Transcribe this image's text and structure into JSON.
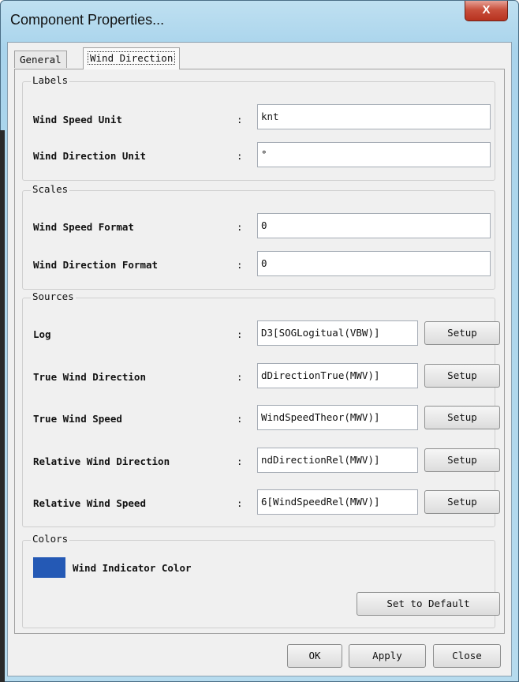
{
  "window": {
    "title": "Component Properties...",
    "close_glyph": "X"
  },
  "tabs": [
    {
      "label": "General"
    },
    {
      "label": "Wind Direction"
    }
  ],
  "labels_group": {
    "title": "Labels",
    "rows": [
      {
        "label": "Wind Speed Unit",
        "colon": ":",
        "value": "knt"
      },
      {
        "label": "Wind Direction Unit",
        "colon": ":",
        "value": "°"
      }
    ]
  },
  "scales_group": {
    "title": "Scales",
    "rows": [
      {
        "label": "Wind Speed Format",
        "colon": ":",
        "value": "0"
      },
      {
        "label": "Wind Direction Format",
        "colon": ":",
        "value": "0"
      }
    ]
  },
  "sources_group": {
    "title": "Sources",
    "setup_label": "Setup",
    "rows": [
      {
        "label": "Log",
        "colon": ":",
        "value": "D3[SOGLogitual(VBW)]"
      },
      {
        "label": "True Wind Direction",
        "colon": ":",
        "value": "dDirectionTrue(MWV)]"
      },
      {
        "label": "True Wind Speed",
        "colon": ":",
        "value": "WindSpeedTheor(MWV)]"
      },
      {
        "label": "Relative Wind Direction",
        "colon": ":",
        "value": "ndDirectionRel(MWV)]"
      },
      {
        "label": "Relative Wind Speed",
        "colon": ":",
        "value": "6[WindSpeedRel(MWV)]"
      }
    ]
  },
  "colors_group": {
    "title": "Colors",
    "indicator_label": "Wind Indicator Color",
    "indicator_color": "#2459b5",
    "default_button": "Set to Default"
  },
  "footer": {
    "ok": "OK",
    "apply": "Apply",
    "close": "Close"
  }
}
